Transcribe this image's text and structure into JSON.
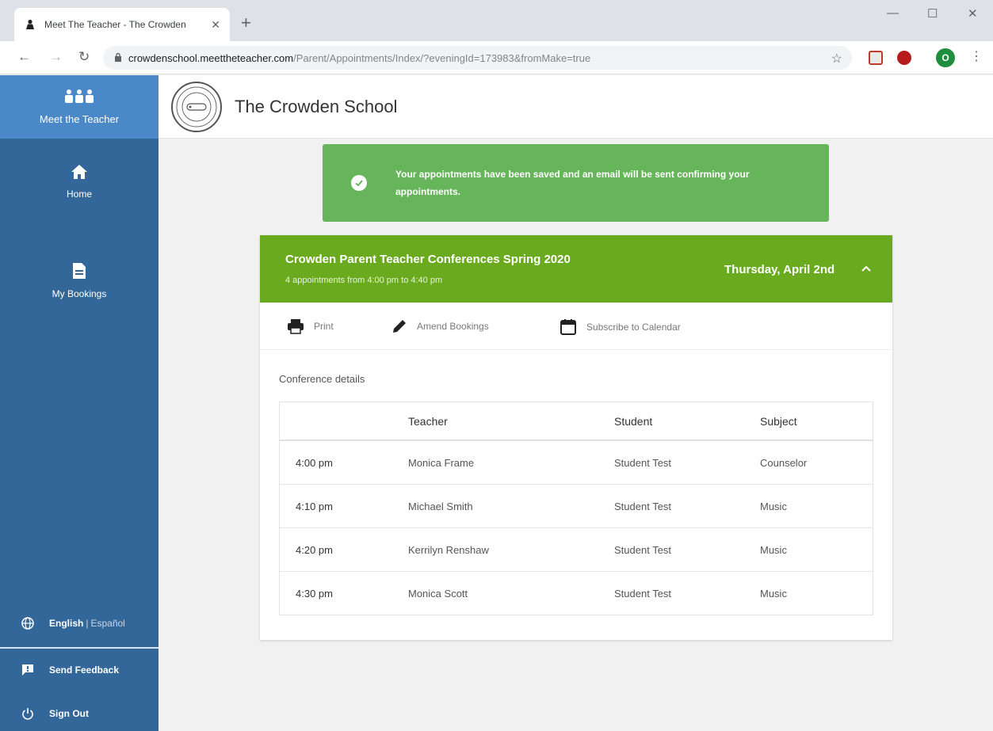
{
  "browser": {
    "tab_title": "Meet The Teacher - The Crowden",
    "url_host": "crowdenschool.meettheteacher.com",
    "url_path": "/Parent/Appointments/Index/?eveningId=173983&fromMake=true",
    "profile_initial": "O"
  },
  "sidebar": {
    "brand_label": "Meet the Teacher",
    "items": [
      {
        "label": "Home",
        "icon": "home-icon"
      },
      {
        "label": "My Bookings",
        "icon": "document-icon"
      }
    ],
    "language_primary": "English",
    "language_separator": "|",
    "language_alt": "Español",
    "feedback_label": "Send Feedback",
    "signout_label": "Sign Out"
  },
  "header": {
    "school_name": "The Crowden School"
  },
  "alert": {
    "message": "Your appointments have been saved and an email will be sent confirming your appointments."
  },
  "event": {
    "title": "Crowden Parent Teacher Conferences Spring 2020",
    "subtitle": "4 appointments from 4:00 pm to 4:40 pm",
    "date": "Thursday, April 2nd"
  },
  "actions": {
    "print": "Print",
    "amend": "Amend Bookings",
    "subscribe": "Subscribe to Calendar"
  },
  "details": {
    "label": "Conference details",
    "columns": [
      "",
      "Teacher",
      "Student",
      "Subject"
    ],
    "rows": [
      {
        "time": "4:00 pm",
        "teacher": "Monica Frame",
        "student": "Student Test",
        "subject": "Counselor"
      },
      {
        "time": "4:10 pm",
        "teacher": "Michael Smith",
        "student": "Student Test",
        "subject": "Music"
      },
      {
        "time": "4:20 pm",
        "teacher": "Kerrilyn Renshaw",
        "student": "Student Test",
        "subject": "Music"
      },
      {
        "time": "4:30 pm",
        "teacher": "Monica Scott",
        "student": "Student Test",
        "subject": "Music"
      }
    ]
  },
  "colors": {
    "sidebar": "#336799",
    "brand": "#4a88c7",
    "success": "#66b55a",
    "event_header": "#6aaa1e"
  }
}
